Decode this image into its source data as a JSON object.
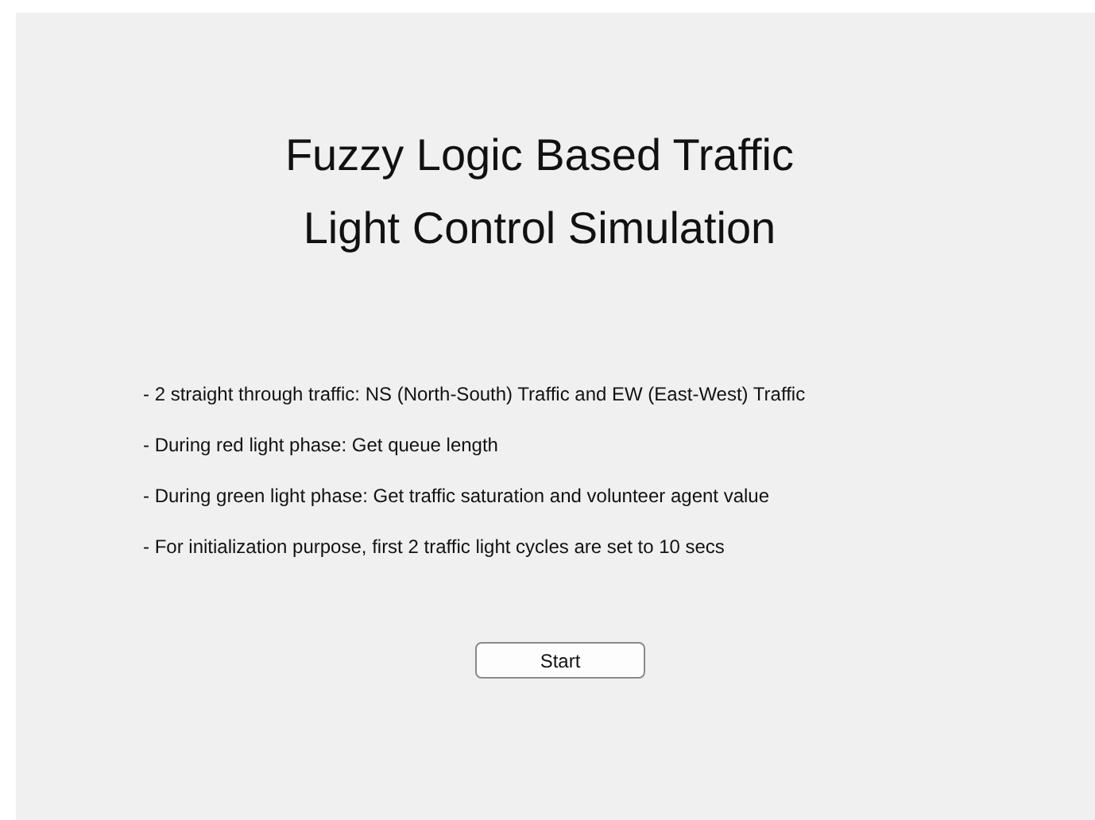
{
  "title_lines": [
    "Fuzzy Logic Based Traffic",
    "Light Control Simulation"
  ],
  "notes": [
    "- 2 straight through traffic: NS (North-South) Traffic and EW (East-West) Traffic",
    "- During red light phase: Get queue length",
    "- During green light phase: Get traffic saturation and volunteer agent value",
    "- For initialization purpose, first 2 traffic light cycles are set to 10 secs"
  ],
  "start_button": "Start"
}
